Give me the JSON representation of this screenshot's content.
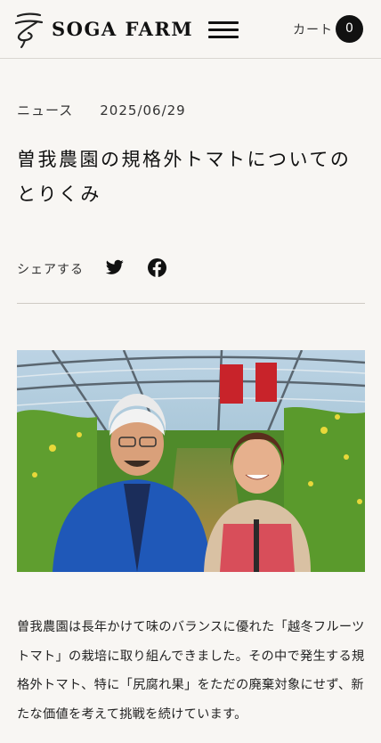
{
  "header": {
    "brand": "SOGA FARM",
    "cart_label": "カート",
    "cart_count": "0"
  },
  "article": {
    "category": "ニュース",
    "date": "2025/06/29",
    "title": "曽我農園の規格外トマトについてのとりくみ",
    "share_label": "シェアする",
    "body": "曽我農園は長年かけて味のバランスに優れた「越冬フルーツトマト」の栽培に取り組んできました。その中で発生する規格外トマト、特に「尻腐れ果」をただの廃棄対象にせず、新たな価値を考えて挑戦を続けています。"
  },
  "icons": {
    "logo": "soga-farm-logo",
    "menu": "hamburger-icon",
    "share_twitter": "twitter-icon",
    "share_facebook": "facebook-icon"
  },
  "colors": {
    "background": "#f8f6f3",
    "text": "#222222",
    "badge": "#111111",
    "divider": "#cfcac4"
  }
}
